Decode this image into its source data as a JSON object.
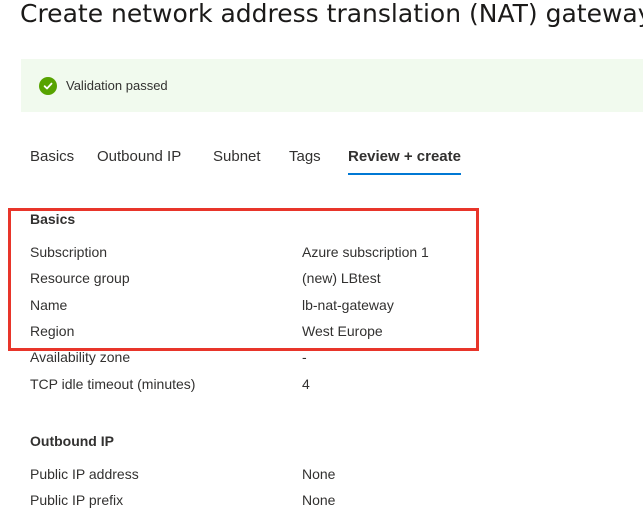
{
  "page": {
    "title": "Create network address translation (NAT) gateway"
  },
  "validation": {
    "message": "Validation passed",
    "icon": "checkmark-circle-icon",
    "color": "#57a300"
  },
  "tabs": [
    {
      "label": "Basics",
      "active": false
    },
    {
      "label": "Outbound IP",
      "active": false
    },
    {
      "label": "Subnet",
      "active": false
    },
    {
      "label": "Tags",
      "active": false
    },
    {
      "label": "Review + create",
      "active": true
    }
  ],
  "basics": {
    "heading": "Basics",
    "rows": [
      {
        "label": "Subscription",
        "value": "Azure subscription 1"
      },
      {
        "label": "Resource group",
        "value": "(new) LBtest"
      },
      {
        "label": "Name",
        "value": "lb-nat-gateway"
      },
      {
        "label": "Region",
        "value": "West Europe"
      },
      {
        "label": "Availability zone",
        "value": "-"
      },
      {
        "label": "TCP idle timeout (minutes)",
        "value": "4"
      }
    ]
  },
  "outbound_ip": {
    "heading": "Outbound IP",
    "rows": [
      {
        "label": "Public IP address",
        "value": "None"
      },
      {
        "label": "Public IP prefix",
        "value": "None"
      }
    ]
  },
  "colors": {
    "accent": "#0078d4",
    "highlight": "#e8352a",
    "banner_background": "#f1faee"
  }
}
